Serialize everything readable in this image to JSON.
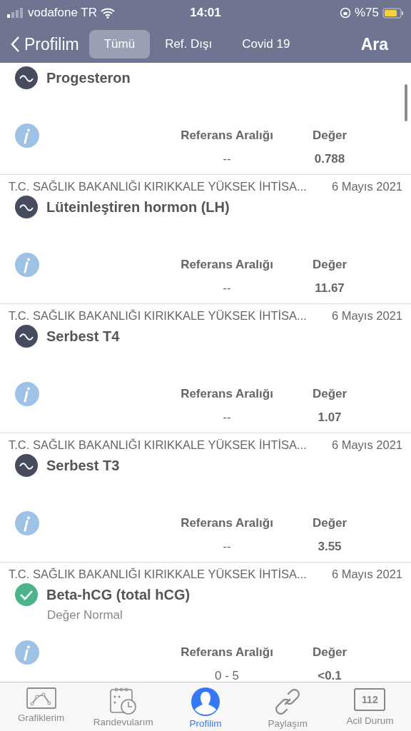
{
  "status_bar": {
    "carrier": "vodafone TR",
    "time": "14:01",
    "battery": "%75"
  },
  "nav": {
    "back": "Profilim",
    "action": "Ara",
    "tabs": [
      {
        "label": "Tümü",
        "selected": true
      },
      {
        "label": "Ref. Dışı",
        "selected": false
      },
      {
        "label": "Covid 19",
        "selected": false
      }
    ]
  },
  "results": [
    {
      "kind": "trend",
      "title": "Progesteron",
      "ref_label": "Referans Aralığı",
      "value_label": "Değer",
      "ref": "--",
      "value": "0.788"
    },
    {
      "kind": "trend",
      "source": "T.C. SAĞLIK BAKANLIĞI KIRIKKALE YÜKSEK İHTİSA...",
      "date": "6 Mayıs 2021",
      "title": "Lüteinleştiren hormon (LH)",
      "ref_label": "Referans Aralığı",
      "value_label": "Değer",
      "ref": "--",
      "value": "11.67"
    },
    {
      "kind": "trend",
      "source": "T.C. SAĞLIK BAKANLIĞI KIRIKKALE YÜKSEK İHTİSA...",
      "date": "6 Mayıs 2021",
      "title": "Serbest T4",
      "ref_label": "Referans Aralığı",
      "value_label": "Değer",
      "ref": "--",
      "value": "1.07"
    },
    {
      "kind": "trend",
      "source": "T.C. SAĞLIK BAKANLIĞI KIRIKKALE YÜKSEK İHTİSA...",
      "date": "6 Mayıs 2021",
      "title": "Serbest T3",
      "ref_label": "Referans Aralığı",
      "value_label": "Değer",
      "ref": "--",
      "value": "3.55"
    },
    {
      "kind": "normal",
      "source": "T.C. SAĞLIK BAKANLIĞI KIRIKKALE YÜKSEK İHTİSA...",
      "date": "6 Mayıs 2021",
      "title": "Beta-hCG (total hCG)",
      "subtitle": "Değer Normal",
      "ref_label": "Referans Aralığı",
      "value_label": "Değer",
      "ref": "0 - 5",
      "value": "<0.1"
    }
  ],
  "tab_bar": [
    {
      "kind": "chart",
      "label": "Grafiklerim",
      "selected": false
    },
    {
      "kind": "calendar",
      "label": "Randevularım",
      "selected": false
    },
    {
      "kind": "profile",
      "label": "Profilim",
      "selected": true
    },
    {
      "kind": "link",
      "label": "Paylaşım",
      "selected": false
    },
    {
      "kind": "emergency",
      "label": "Acil Durum",
      "badge": "112",
      "selected": false
    }
  ]
}
